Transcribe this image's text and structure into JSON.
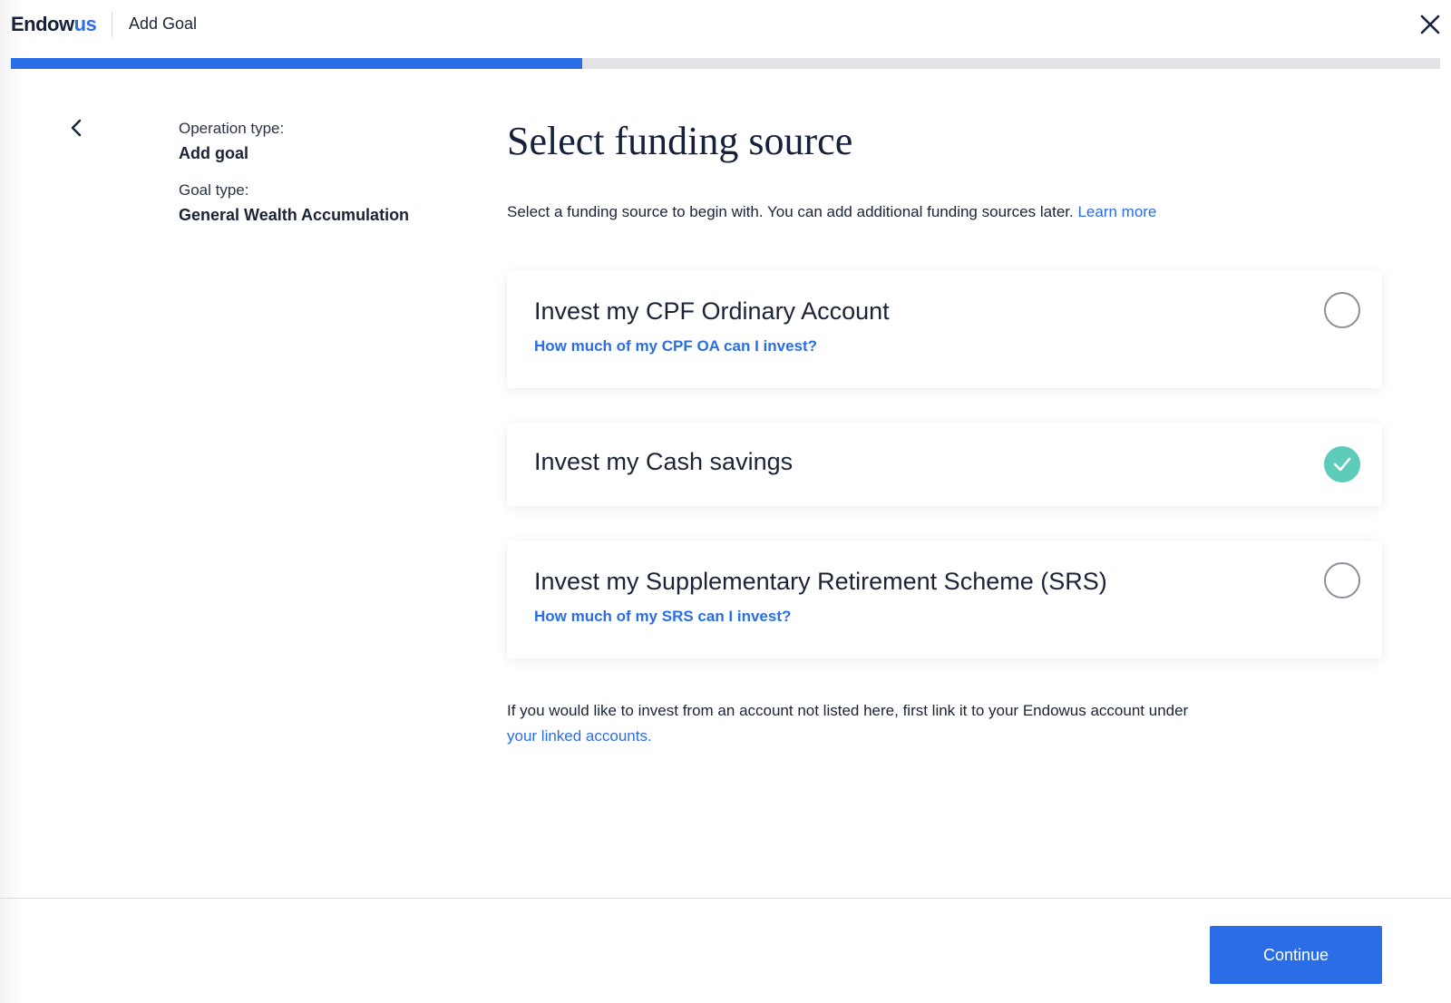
{
  "header": {
    "logo_main": "Endow",
    "logo_accent": "us",
    "title": "Add Goal"
  },
  "progress": {
    "fraction": 0.4
  },
  "sidebar": {
    "operation_label": "Operation type:",
    "operation_value": "Add goal",
    "goal_label": "Goal type:",
    "goal_value": "General Wealth Accumulation"
  },
  "main": {
    "title": "Select funding source",
    "intro_text": "Select a funding source to begin with. You can add additional funding sources later.",
    "intro_link": "Learn more",
    "options": [
      {
        "title": "Invest my CPF Ordinary Account",
        "link": "How much of my CPF OA can I invest?",
        "selected": false
      },
      {
        "title": "Invest my Cash savings",
        "link": "",
        "selected": true
      },
      {
        "title": "Invest my Supplementary Retirement Scheme (SRS)",
        "link": "How much of my SRS can I invest?",
        "selected": false
      }
    ],
    "footnote_text": "If you would like to invest from an account not listed here, first link it to your Endowus account under",
    "footnote_link": "your linked accounts."
  },
  "footer": {
    "continue_label": "Continue"
  },
  "colors": {
    "accent": "#2a6de6",
    "selected": "#5ccbba",
    "text": "#1b2337"
  },
  "icons": {
    "close": "close-icon",
    "back": "chevron-left-icon",
    "check": "check-icon"
  }
}
